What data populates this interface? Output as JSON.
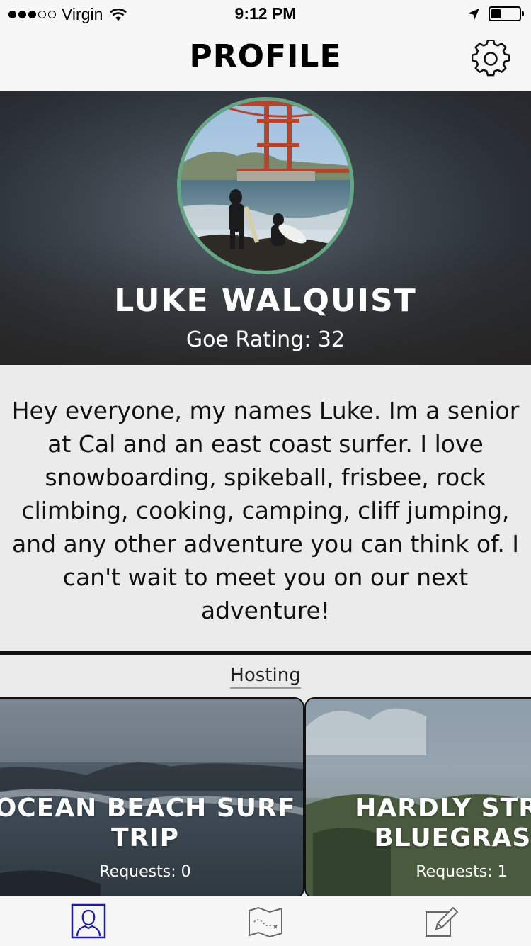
{
  "status_bar": {
    "carrier": "Virgin",
    "time": "9:12 PM",
    "signal_bars_filled": 3,
    "signal_bars_total": 5
  },
  "nav": {
    "title": "PROFILE",
    "settings_icon": "gear-icon"
  },
  "profile": {
    "name": "LUKE WALQUIST",
    "rating_text": "Goe Rating: 32",
    "avatar_ring_color": "#63a882",
    "bio": "Hey everyone, my names Luke. Im a senior at Cal and an east coast surfer. I love snowboarding, spikeball, frisbee, rock climbing, cooking, camping, cliff jumping, and any other adventure you can think of. I can't wait to meet you on our next adventure!"
  },
  "hosting": {
    "label": "Hosting",
    "cards": [
      {
        "title": "OCEAN BEACH SURF TRIP",
        "requests": "Requests: 0"
      },
      {
        "title": "HARDLY STRIC BLUEGRASS",
        "requests": "Requests: 1"
      }
    ]
  },
  "tab_bar": {
    "tabs": [
      {
        "icon": "profile-icon",
        "active": true,
        "active_color": "#1a1ab8"
      },
      {
        "icon": "map-icon",
        "active": false
      },
      {
        "icon": "compose-icon",
        "active": false
      }
    ]
  }
}
